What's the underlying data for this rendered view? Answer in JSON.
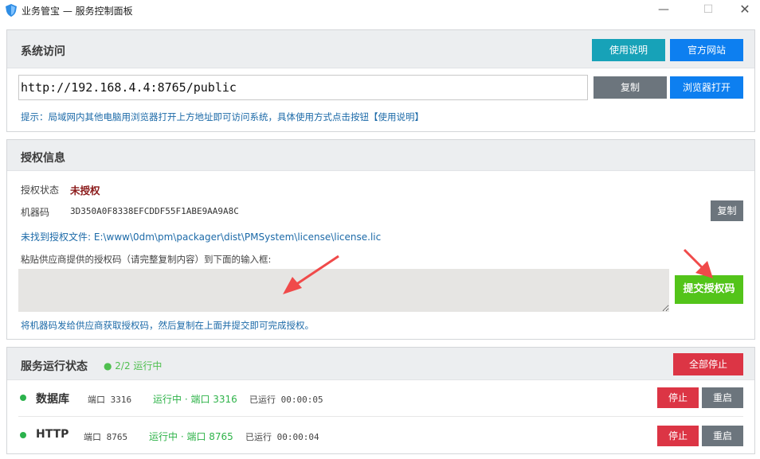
{
  "window": {
    "title": "业务管宝 — 服务控制面板",
    "controls": {
      "minimize": "—",
      "maximize": "☐",
      "close": "✕"
    }
  },
  "colors": {
    "teal": "#17a2b8",
    "blue": "#0d7ff0",
    "gray": "#6c757d",
    "green": "#53c41a",
    "red": "#dc3545",
    "link": "#1c6aa8",
    "unlicensed": "#8b1a1a"
  },
  "access": {
    "title": "系统访问",
    "manual_button": "使用说明",
    "website_button": "官方网站",
    "url_value": "http://192.168.4.4:8765/public",
    "copy_button": "复制",
    "open_browser_button": "浏览器打开",
    "hint": "提示：局域网内其他电脑用浏览器打开上方地址即可访问系统，具体使用方式点击按钮【使用说明】"
  },
  "license": {
    "title": "授权信息",
    "status_label": "授权状态",
    "status_value": "未授权",
    "machine_label": "机器码",
    "machine_code": "3D350A0F8338EFCDDF55F1ABE9AA9A8C",
    "copy_button": "复制",
    "not_found": "未找到授权文件: E:\\www\\0dm\\pm\\packager\\dist\\PMSystem\\license\\license.lic",
    "paste_label": "粘贴供应商提供的授权码（请完整复制内容）到下面的输入框:",
    "input_value": "",
    "submit_button": "提交授权码",
    "footer_hint": "将机器码发给供应商获取授权码，然后复制在上面并提交即可完成授权。"
  },
  "services": {
    "title": "服务运行状态",
    "count": "● 2/2 运行中",
    "stop_all_button": "全部停止",
    "items": [
      {
        "name": "数据库",
        "port": "端口 3316",
        "status": "运行中 · 端口 3316",
        "uptime": "已运行 00:00:05",
        "stop": "停止",
        "restart": "重启"
      },
      {
        "name": "HTTP",
        "port": "端口 8765",
        "status": "运行中 · 端口 8765",
        "uptime": "已运行 00:00:04",
        "stop": "停止",
        "restart": "重启"
      }
    ]
  }
}
